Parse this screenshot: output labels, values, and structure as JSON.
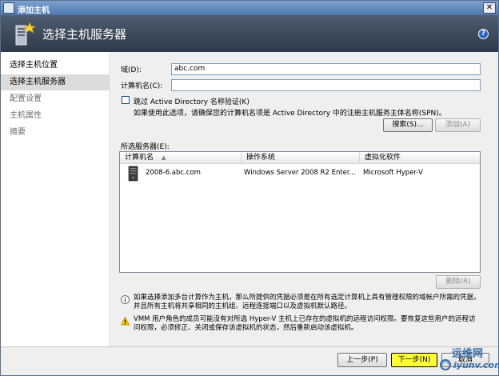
{
  "window": {
    "title": "添加主机",
    "close_label": "✕"
  },
  "header": {
    "title": "选择主机服务器",
    "help_label": "?"
  },
  "nav": {
    "items": [
      {
        "label": "选择主机位置",
        "state": "normal"
      },
      {
        "label": "选择主机服务器",
        "state": "active"
      },
      {
        "label": "配置设置",
        "state": "disabled"
      },
      {
        "label": "主机属性",
        "state": "disabled"
      },
      {
        "label": "摘要",
        "state": "disabled"
      }
    ]
  },
  "form": {
    "domain_label": "域(D):",
    "domain_value": "abc.com",
    "computer_label": "计算机名(C):",
    "computer_value": "",
    "skip_ad_label": "跳过 Active Directory 名称验证(K)",
    "skip_ad_checked": false,
    "spn_hint": "如果使用此选项，请确保您的计算机名项是 Active Directory 中的注册主机服务主体名称(SPN)。",
    "search_button": "搜索(S)...",
    "add_button": "添加(A)"
  },
  "selected_servers": {
    "label": "所选服务器(E):",
    "columns": [
      "计算机名",
      "操作系统",
      "虚拟化软件"
    ],
    "rows": [
      {
        "name": "2008-6.abc.com",
        "os": "Windows Server 2008 R2 Enter...",
        "virt": "Microsoft Hyper-V"
      }
    ],
    "remove_button": "删除(R)"
  },
  "notices": {
    "info": "如果选择添加多台计算作为主机，那么所提供的凭据必须是在所有选定计算机上具有管理权限的域帐户所需的凭据，并且所有主机将共享相同的主机组、远程连接端口以及虚拟机默认路径。",
    "warning": "VMM 用户角色的成员可能没有对所选 Hyper-V 主机上已存在的虚拟机的远程访问权限。要恢复这些用户的远程访问权限，必须修正、关闭或保存该虚拟机的状态，然后重新启动该虚拟机。"
  },
  "footer": {
    "back_button": "上一步(P)",
    "next_button": "下一步(N)",
    "cancel_button": "取消"
  },
  "watermark": {
    "line1": "运维网",
    "line2": "iyunv.com"
  },
  "colors": {
    "titlebar": "#4e78b0",
    "header": "#2e3a4a",
    "content_bg": "#efefef",
    "next_highlight": "#ffff33"
  }
}
